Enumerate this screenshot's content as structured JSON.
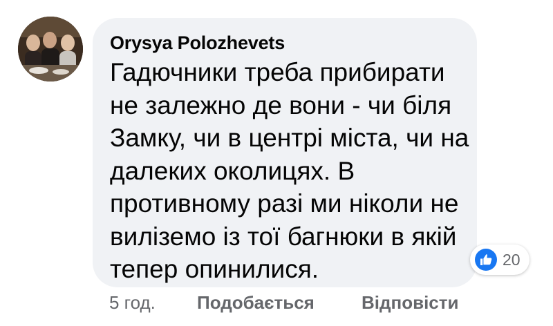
{
  "comment": {
    "author": "Orysya Polozhevets",
    "lines": [
      "Гадючники треба прибирати",
      "не залежно де вони - чи біля",
      "Замку, чи в центрі міста, чи на",
      "далеких околицях. В",
      "противному разі ми ніколи не",
      "виліземо із тої багнюки в якій",
      "тепер опинилися."
    ]
  },
  "reactions": {
    "icon": "thumbs-up-icon",
    "count": "20",
    "color": "#1877f2"
  },
  "actions": {
    "time": "5 год.",
    "like_label": "Подобається",
    "reply_label": "Відповісти"
  },
  "colors": {
    "bubble_bg": "#f0f2f5",
    "text": "#050505",
    "secondary_text": "#65676b"
  }
}
